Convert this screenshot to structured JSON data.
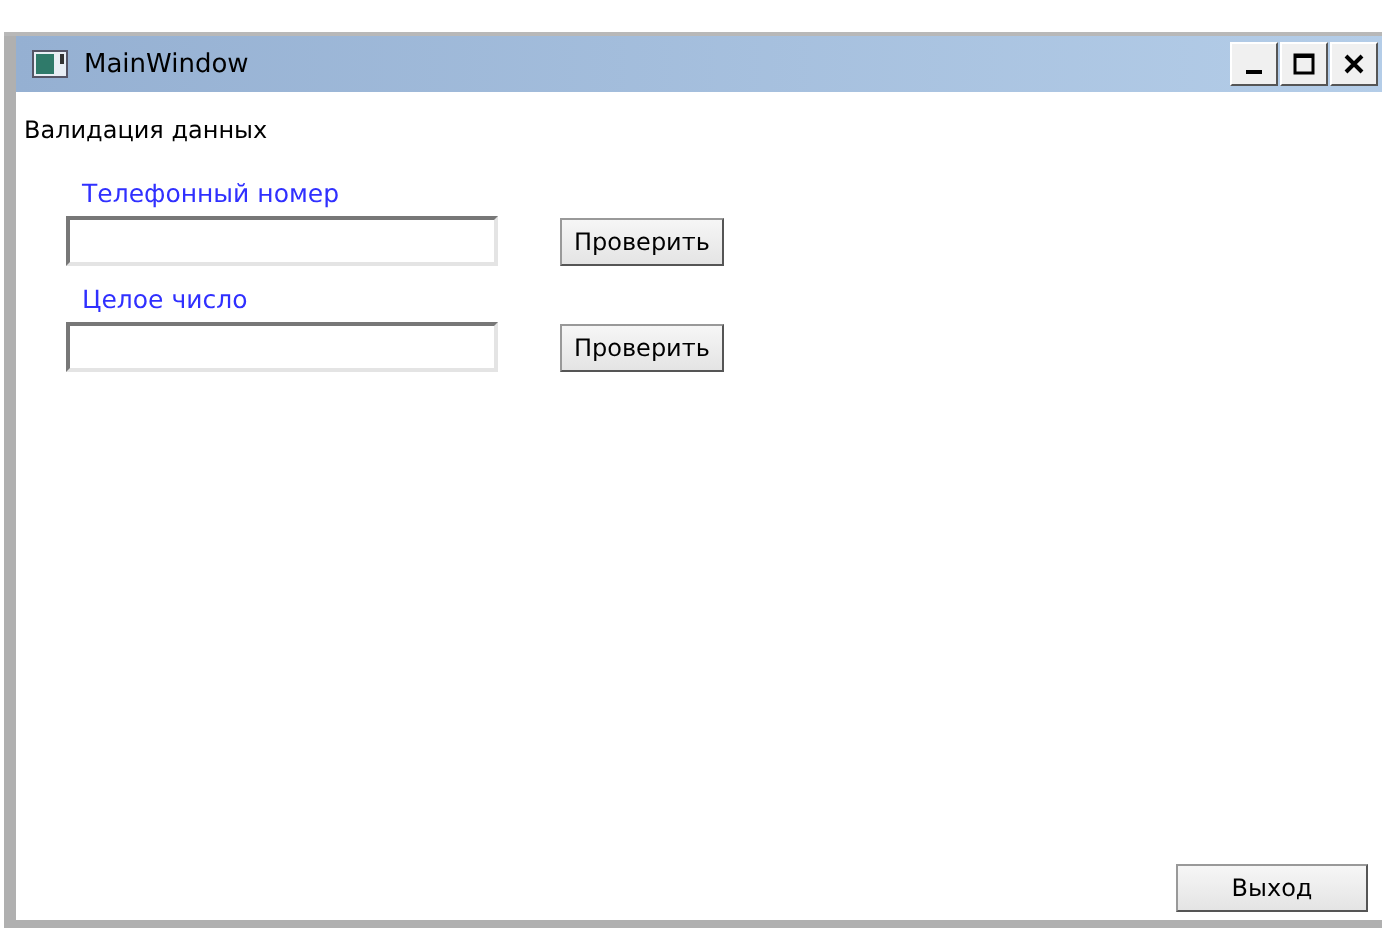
{
  "window": {
    "title": "MainWindow"
  },
  "heading": "Валидация данных",
  "fields": [
    {
      "label": "Телефонный номер",
      "button": "Проверить"
    },
    {
      "label": "Целое число",
      "button": "Проверить"
    }
  ],
  "exit_button": "Выход"
}
